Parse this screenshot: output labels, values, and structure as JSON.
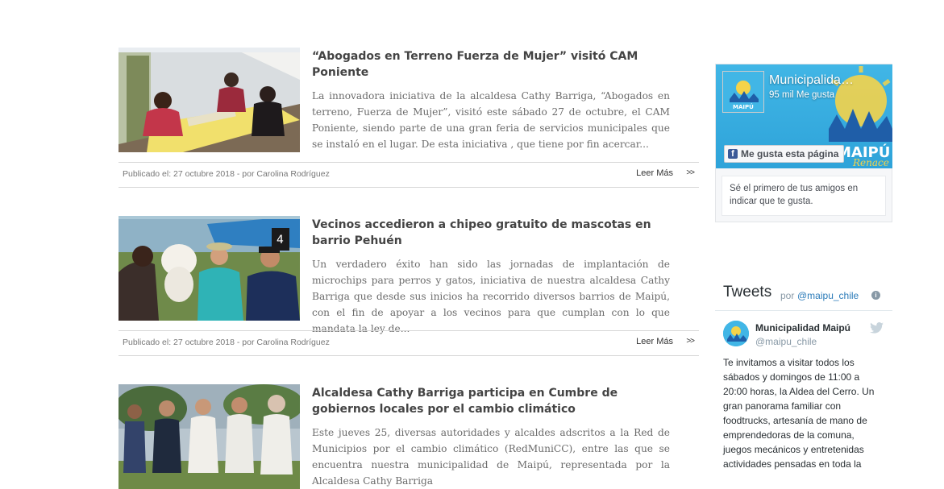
{
  "posts": [
    {
      "title": "“Abogados en Terreno Fuerza de Mujer” visitó CAM Poniente",
      "excerpt": "La innovadora iniciativa de la alcaldesa Cathy Barriga, “Abogados en terreno, Fuerza de Mujer”, visitó este sábado 27 de octubre,  el CAM Poniente, siendo parte de una gran feria de servicios municipales que se instaló en el lugar. De esta iniciativa , que tiene por fin acercar...",
      "meta": "Publicado el: 27 octubre 2018 - por Carolina Rodríguez",
      "read_more": "Leer Más",
      "arrow": ">>"
    },
    {
      "title": "Vecinos accedieron a chipeo gratuito de mascotas en barrio Pehuén",
      "excerpt": "Un verdadero éxito han sido las jornadas de implantación de microchips para perros y gatos, iniciativa de nuestra alcaldesa Cathy Barriga que desde sus inicios ha recorrido diversos barrios de Maipú, con el fin de apoyar a los vecinos para que cumplan con lo que mandata la ley de...",
      "meta": "Publicado el: 27 octubre 2018 - por Carolina Rodríguez",
      "read_more": "Leer Más",
      "arrow": ">>"
    },
    {
      "title": "Alcaldesa Cathy Barriga participa en Cumbre de gobiernos locales por el cambio climático",
      "excerpt": "Este jueves 25,  diversas autoridades y alcaldes adscritos a la Red de Municipios por el cambio climático (RedMuniCC), entre las que se encuentra nuestra municipalidad de Maipú, representada por la Alcaldesa Cathy Barriga"
    }
  ],
  "facebook": {
    "page_name": "Municipalida…",
    "likes": "95 mil Me gusta",
    "like_button": "Me gusta esta página",
    "cover_text": "MAIPÚ",
    "cover_script": "Renace",
    "friends_text": "Sé el primero de tus amigos en indicar que te gusta.",
    "logo_text": "MAIPÚ",
    "accent": "#3b5998"
  },
  "twitter": {
    "heading": "Tweets",
    "by": "por",
    "handle_link": "@maipu_chile",
    "info": "i",
    "tweet": {
      "name": "Municipalidad Maipú",
      "handle": "@maipu_chile",
      "text": "Te invitamos a visitar todos los sábados y domingos de 11:00 a 20:00 horas, la Aldea del Cerro. Un gran panorama familiar con foodtrucks, artesanía de mano de emprendedoras de la comuna, juegos mecánicos y entretenidas actividades pensadas en toda la"
    },
    "accent": "#1da1f2"
  }
}
